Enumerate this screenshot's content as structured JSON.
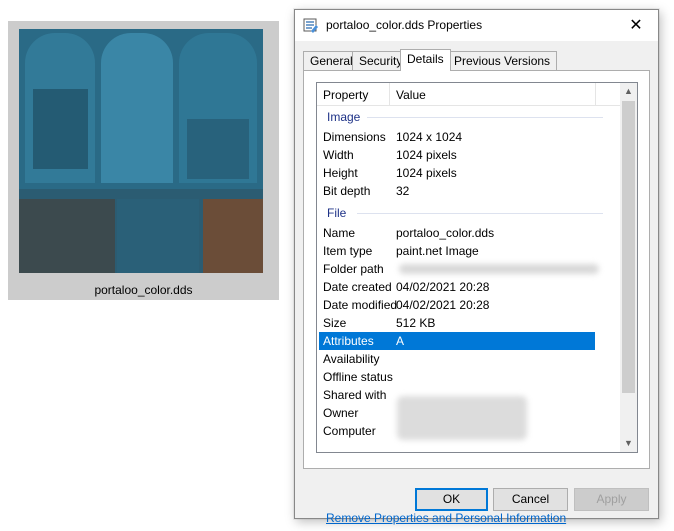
{
  "thumbnail": {
    "file_name": "portaloo_color.dds"
  },
  "dialog": {
    "title": "portaloo_color.dds Properties",
    "close_glyph": "✕",
    "tabs": [
      {
        "label": "General"
      },
      {
        "label": "Security"
      },
      {
        "label": "Details"
      },
      {
        "label": "Previous Versions"
      }
    ],
    "active_tab": "Details",
    "list": {
      "columns": [
        "Property",
        "Value"
      ],
      "groups": {
        "image": "Image",
        "file": "File"
      },
      "image_rows": [
        {
          "key": "Dimensions",
          "value": "1024 x 1024"
        },
        {
          "key": "Width",
          "value": "1024 pixels"
        },
        {
          "key": "Height",
          "value": "1024 pixels"
        },
        {
          "key": "Bit depth",
          "value": "32"
        }
      ],
      "file_rows": [
        {
          "key": "Name",
          "value": "portaloo_color.dds"
        },
        {
          "key": "Item type",
          "value": "paint.net Image"
        },
        {
          "key": "Folder path",
          "value": ""
        },
        {
          "key": "Date created",
          "value": "04/02/2021 20:28"
        },
        {
          "key": "Date modified",
          "value": "04/02/2021 20:28"
        },
        {
          "key": "Size",
          "value": "512 KB"
        },
        {
          "key": "Attributes",
          "value": "A"
        },
        {
          "key": "Availability",
          "value": ""
        },
        {
          "key": "Offline status",
          "value": ""
        },
        {
          "key": "Shared with",
          "value": ""
        },
        {
          "key": "Owner",
          "value": ""
        },
        {
          "key": "Computer",
          "value": ""
        }
      ],
      "selected_row": "Attributes"
    },
    "remove_link": "Remove Properties and Personal Information",
    "buttons": {
      "ok": "OK",
      "cancel": "Cancel",
      "apply": "Apply"
    }
  },
  "colors": {
    "selection": "#0078d7",
    "link": "#0066cc",
    "group_heading": "#1e3287"
  }
}
